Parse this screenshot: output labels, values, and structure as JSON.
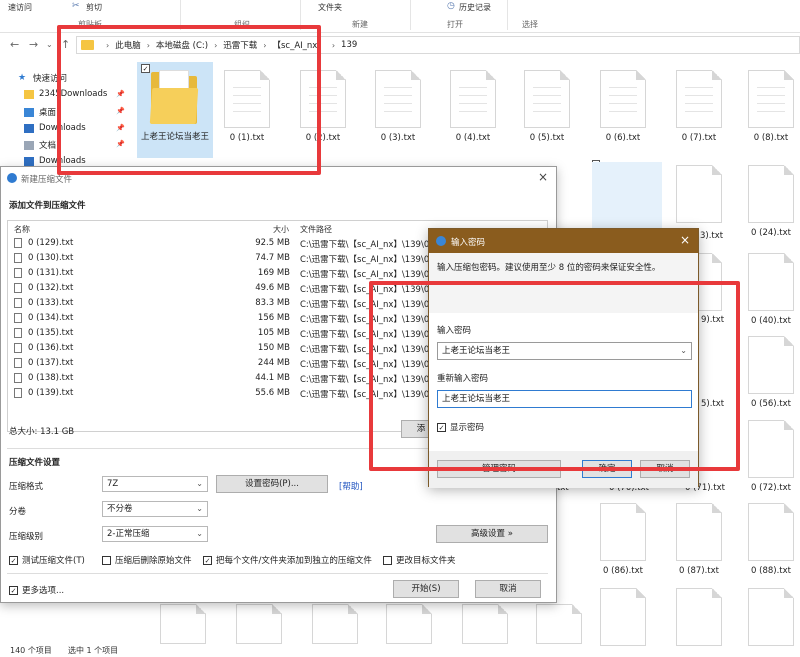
{
  "ribbon": {
    "quick_access": "速访问",
    "cut": "剪切",
    "clipboard_group": "剪贴板",
    "organize_group": "组织",
    "folder_label": "文件夹",
    "new_group": "新建",
    "history": "历史记录",
    "open_group": "打开",
    "select_group": "选择"
  },
  "address": {
    "crumbs": [
      "此电脑",
      "本地磁盘 (C:)",
      "迅雷下载",
      "【sc_AI_nx】",
      "139"
    ]
  },
  "nav": {
    "items": [
      "快速访问",
      "2345Downloads",
      "桌面",
      "Downloads",
      "文档",
      "Downloads"
    ]
  },
  "folder": {
    "name": "上老王论坛当老王"
  },
  "files": {
    "row1": [
      "0 (1).txt",
      "0 (2).txt",
      "0 (3).txt",
      "0 (4).txt",
      "0 (5).txt",
      "0 (6).txt",
      "0 (7).txt",
      "0 (8).txt"
    ],
    "right_col": [
      "0 (24).txt",
      "0 (40).txt",
      "0 (56).txt",
      "0 (72).txt",
      "0 (88).txt"
    ],
    "partial": [
      "3).txt",
      "9).txt",
      "5).txt",
      "0 (70).txt",
      "0 (71).txt",
      "0 (86).txt",
      "0 (87).txt",
      "txt"
    ]
  },
  "status": {
    "count": "140 个项目",
    "selected": "选中 1 个项目"
  },
  "compress_dialog": {
    "title": "新建压缩文件",
    "section_title": "添加文件到压缩文件",
    "columns": {
      "name": "名称",
      "size": "大小",
      "path": "文件路径"
    },
    "rows": [
      {
        "name": "0 (129).txt",
        "size": "92.5 MB",
        "path": "C:\\迅雷下载\\【sc_AI_nx】\\139\\0"
      },
      {
        "name": "0 (130).txt",
        "size": "74.7 MB",
        "path": "C:\\迅雷下载\\【sc_AI_nx】\\139\\0"
      },
      {
        "name": "0 (131).txt",
        "size": "169 MB",
        "path": "C:\\迅雷下载\\【sc_AI_nx】\\139\\0"
      },
      {
        "name": "0 (132).txt",
        "size": "49.6 MB",
        "path": "C:\\迅雷下载\\【sc_AI_nx】\\139\\0"
      },
      {
        "name": "0 (133).txt",
        "size": "83.3 MB",
        "path": "C:\\迅雷下载\\【sc_AI_nx】\\139\\0"
      },
      {
        "name": "0 (134).txt",
        "size": "156 MB",
        "path": "C:\\迅雷下载\\【sc_AI_nx】\\139\\0"
      },
      {
        "name": "0 (135).txt",
        "size": "105 MB",
        "path": "C:\\迅雷下载\\【sc_AI_nx】\\139\\0"
      },
      {
        "name": "0 (136).txt",
        "size": "150 MB",
        "path": "C:\\迅雷下载\\【sc_AI_nx】\\139\\0"
      },
      {
        "name": "0 (137).txt",
        "size": "244 MB",
        "path": "C:\\迅雷下载\\【sc_AI_nx】\\139\\0"
      },
      {
        "name": "0 (138).txt",
        "size": "44.1 MB",
        "path": "C:\\迅雷下载\\【sc_AI_nx】\\139\\0"
      },
      {
        "name": "0 (139).txt",
        "size": "55.6 MB",
        "path": "C:\\迅雷下载\\【sc_AI_nx】\\139\\0"
      }
    ],
    "total_size": "总大小: 13.1 GB",
    "add_btn_partial": "添",
    "settings_title": "压缩文件设置",
    "format_label": "压缩格式",
    "format_value": "7Z",
    "set_password_btn": "设置密码(P)...",
    "help_link": "[帮助]",
    "split_label": "分卷",
    "split_value": "不分卷",
    "level_label": "压缩级别",
    "level_value": "2-正常压缩",
    "advanced_btn": "高级设置 »",
    "chk_test": "测试压缩文件(T)",
    "chk_delete": "压缩后删除原始文件",
    "chk_each": "把每个文件/文件夹添加到独立的压缩文件",
    "chk_change_dir": "更改目标文件夹",
    "more_options": "更多选项...",
    "start_btn": "开始(S)",
    "cancel_btn": "取消"
  },
  "password_dialog": {
    "title": "输入密码",
    "hint": "输入压缩包密码。建议使用至少 8 位的密码来保证安全性。",
    "enter_label": "输入密码",
    "enter_value": "上老王论坛当老王",
    "reenter_label": "重新输入密码",
    "reenter_value": "上老王论坛当老王",
    "show_password": "显示密码",
    "manage_btn": "管理密码",
    "ok_btn": "确定",
    "cancel_btn": "取消"
  }
}
